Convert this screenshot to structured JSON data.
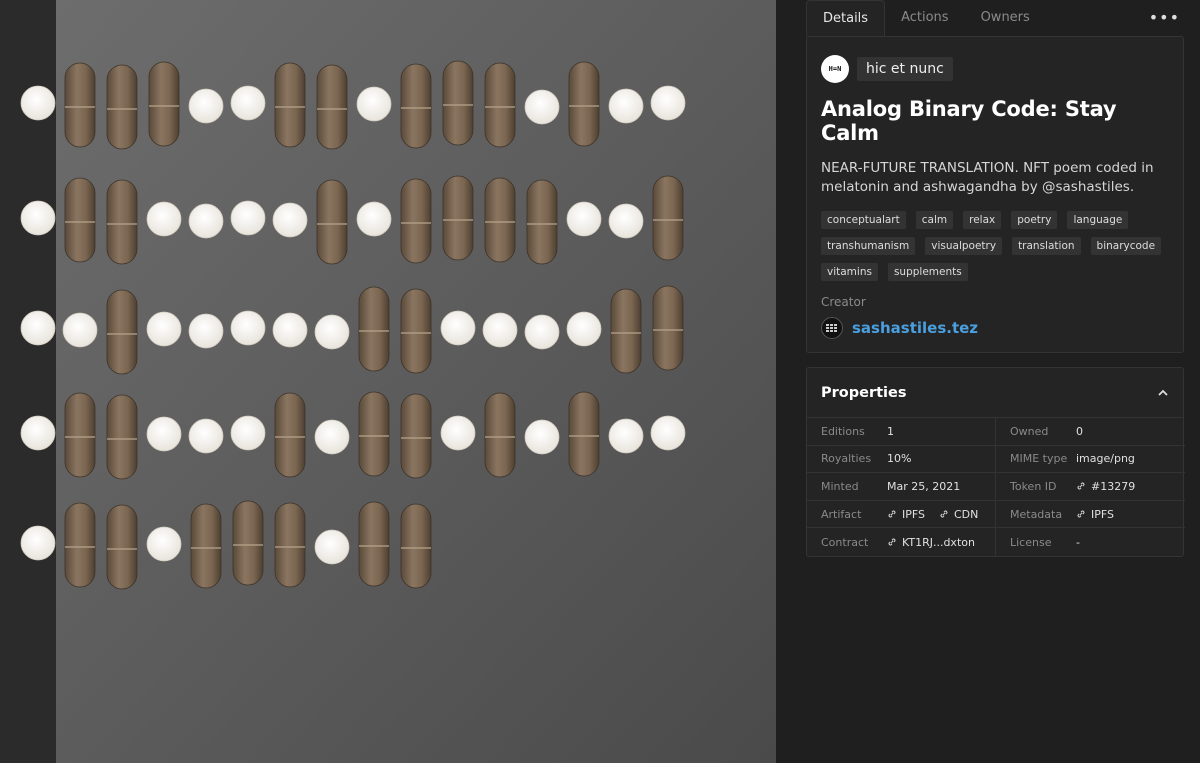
{
  "tabs": [
    {
      "label": "Details",
      "active": true
    },
    {
      "label": "Actions",
      "active": false
    },
    {
      "label": "Owners",
      "active": false
    }
  ],
  "more_label": "•••",
  "platform": {
    "logo_text": "H=N",
    "name": "hic et nunc"
  },
  "token": {
    "title": "Analog Binary Code: Stay Calm",
    "description": "NEAR-FUTURE TRANSLATION. NFT poem coded in melatonin and ashwagandha by @sashastiles."
  },
  "tags": [
    "conceptualart",
    "calm",
    "relax",
    "poetry",
    "language",
    "transhumanism",
    "visualpoetry",
    "translation",
    "binarycode",
    "vitamins",
    "supplements"
  ],
  "creator": {
    "label": "Creator",
    "name": "sashastiles.tez"
  },
  "properties": {
    "title": "Properties",
    "rows": [
      {
        "lk": "Editions",
        "lv": "1",
        "rk": "Owned",
        "rv": "0"
      },
      {
        "lk": "Royalties",
        "lv": "10%",
        "rk": "MIME type",
        "rv": "image/png"
      },
      {
        "lk": "Minted",
        "lv": "Mar 25, 2021",
        "rk": "Token ID",
        "rv": "#13279"
      },
      {
        "lk": "Artifact",
        "lv_links": [
          "IPFS",
          "CDN"
        ],
        "rk": "Metadata",
        "rv": "IPFS"
      },
      {
        "lk": "Contract",
        "lv": "KT1RJ...dxton",
        "rk": "License",
        "rv": "-"
      }
    ]
  },
  "artwork": {
    "rows": [
      "PCCCPPCCPCCCPCPP",
      "PCCPPPPCPCCCCPPC",
      "PPCPPPPPCCPPPPCC",
      "PCCPPPCPCCPCPCPP",
      "PCCPCCCPCC"
    ]
  },
  "colors": {
    "accent": "#4a9fe0",
    "bg": "#1f1f1f",
    "card": "#242424"
  }
}
